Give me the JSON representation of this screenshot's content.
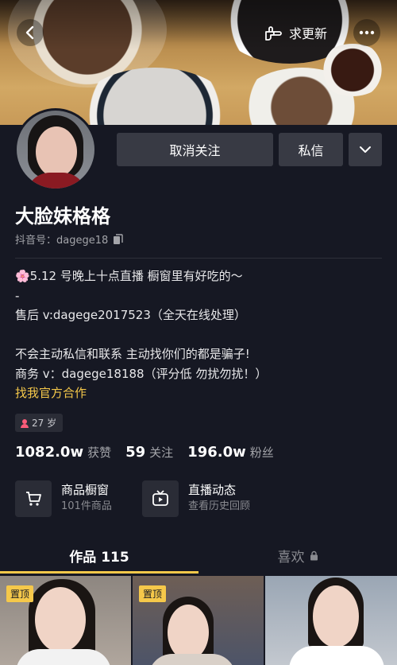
{
  "header": {
    "update_label": "求更新"
  },
  "profile": {
    "name": "大脸妹格格",
    "douyin_id": "抖音号：dagege18",
    "unfollow_label": "取消关注",
    "message_label": "私信",
    "bio_lines": [
      "🌸5.12 号晚上十点直播  橱窗里有好吃的～",
      "-",
      "售后 v:dagege2017523（全天在线处理）",
      "",
      "不会主动私信和联系 主动找你们的都是骗子!",
      "商务 v：dagege18188（评分低 勿扰勿扰！）"
    ],
    "bio_link": "找我官方合作",
    "age_tag": "27 岁",
    "accent_color": "#f5c84a"
  },
  "stats": [
    {
      "num": "1082.0w",
      "label": "获赞"
    },
    {
      "num": "59",
      "label": "关注"
    },
    {
      "num": "196.0w",
      "label": "粉丝"
    }
  ],
  "features": {
    "shop": {
      "title": "商品橱窗",
      "subtitle": "101件商品"
    },
    "live": {
      "title": "直播动态",
      "subtitle": "查看历史回顾"
    }
  },
  "tabs": {
    "works": "作品 115",
    "likes": "喜欢"
  },
  "videos": [
    {
      "pinned_label": "置顶"
    },
    {
      "pinned_label": "置顶"
    },
    {
      "pinned_label": ""
    }
  ]
}
